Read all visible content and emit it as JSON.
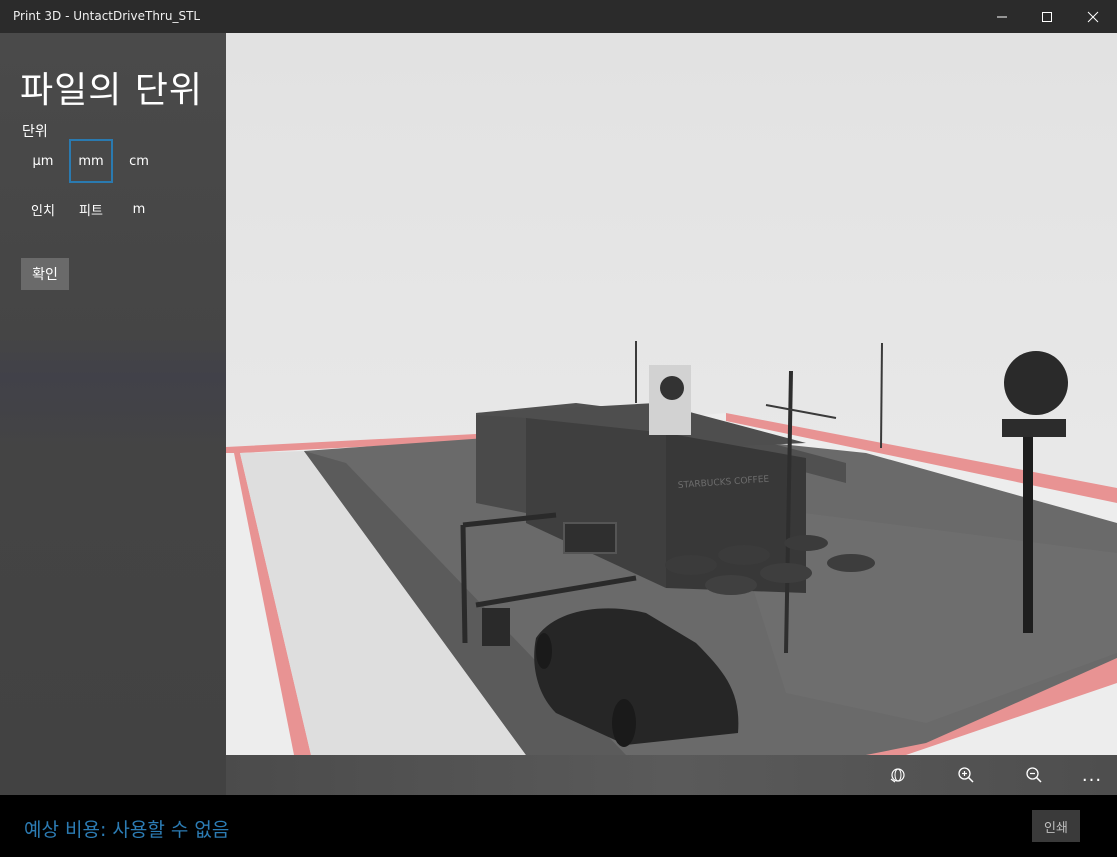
{
  "window": {
    "title": "Print 3D - UntactDriveThru_STL"
  },
  "panel": {
    "title": "파일의 단위",
    "unit_label": "단위",
    "units": [
      "µm",
      "mm",
      "cm",
      "인치",
      "피트",
      "m"
    ],
    "selected_unit": "mm",
    "confirm_label": "확인"
  },
  "scene": {
    "sign_text": "STARBUCKS COFFEE"
  },
  "toolbar": {
    "icons": [
      "rotate-icon",
      "zoom-in-icon",
      "zoom-out-icon",
      "more-icon"
    ],
    "more_label": "..."
  },
  "footer": {
    "estimated_cost": "예상 비용: 사용할 수 없음",
    "print_label": "인쇄"
  },
  "colors": {
    "accent": "#2c7cb4",
    "selection_border": "#2a7ab0",
    "bed_border": "#e89393"
  }
}
